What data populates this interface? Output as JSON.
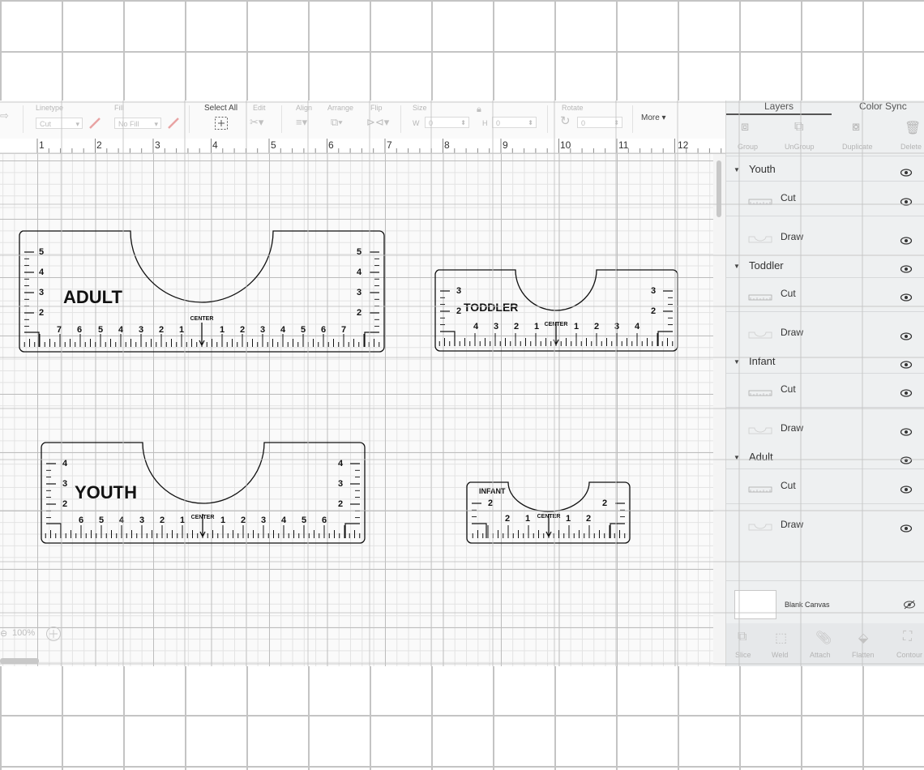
{
  "toolbar": {
    "linetype_label": "Linetype",
    "linetype_value": "Cut",
    "fill_label": "Fill",
    "fill_value": "No Fill",
    "select_all_label": "Select All",
    "edit_label": "Edit",
    "align_label": "Align",
    "arrange_label": "Arrange",
    "flip_label": "Flip",
    "size_label": "Size",
    "size_w_label": "W",
    "size_w_value": "0",
    "size_h_label": "H",
    "size_h_value": "0",
    "rotate_label": "Rotate",
    "rotate_value": "0",
    "more_label": "More ▾"
  },
  "ruler": {
    "labels": [
      "1",
      "2",
      "3",
      "4",
      "5",
      "6",
      "7",
      "8",
      "9",
      "10",
      "11",
      "12"
    ]
  },
  "canvas": {
    "zoom_value": "100%",
    "rulers": [
      {
        "name": "Adult",
        "title": "ADULT",
        "center_label": "CENTER",
        "scale_labels": [
          "7",
          "6",
          "5",
          "4",
          "3",
          "2",
          "1",
          "1",
          "2",
          "3",
          "4",
          "5",
          "6",
          "7"
        ],
        "side_labels": [
          "5",
          "4",
          "3",
          "2"
        ]
      },
      {
        "name": "Toddler",
        "title": "TODDLER",
        "center_label": "CENTER",
        "scale_labels": [
          "4",
          "3",
          "2",
          "1",
          "1",
          "2",
          "3",
          "4"
        ],
        "side_labels": [
          "3",
          "2"
        ]
      },
      {
        "name": "Youth",
        "title": "YOUTH",
        "center_label": "CENTER",
        "scale_labels": [
          "6",
          "5",
          "4",
          "3",
          "2",
          "1",
          "1",
          "2",
          "3",
          "4",
          "5",
          "6"
        ],
        "side_labels": [
          "4",
          "3",
          "2"
        ]
      },
      {
        "name": "Infant",
        "title": "INFANT",
        "center_label": "CENTER",
        "scale_labels": [
          "2",
          "1",
          "1",
          "2"
        ],
        "side_labels": [
          "2"
        ]
      }
    ]
  },
  "panel": {
    "tabs": [
      "Layers",
      "Color Sync"
    ],
    "actions": [
      "Group",
      "UnGroup",
      "Duplicate",
      "Delete"
    ],
    "layers": [
      {
        "name": "Youth",
        "children": [
          "Cut",
          "Draw"
        ]
      },
      {
        "name": "Toddler",
        "children": [
          "Cut",
          "Draw"
        ]
      },
      {
        "name": "Infant",
        "children": [
          "Cut",
          "Draw"
        ]
      },
      {
        "name": "Adult",
        "children": [
          "Cut",
          "Draw"
        ]
      }
    ],
    "blank_canvas_label": "Blank Canvas",
    "bottom_actions": [
      "Slice",
      "Weld",
      "Attach",
      "Flatten",
      "Contour"
    ]
  },
  "colors": {
    "grid_major": "#bdbdbd",
    "grid_minor": "#e3e3e3",
    "panel_bg": "#eef0f1",
    "outer_grid": "#c4c4c4",
    "ink": "#111111"
  }
}
